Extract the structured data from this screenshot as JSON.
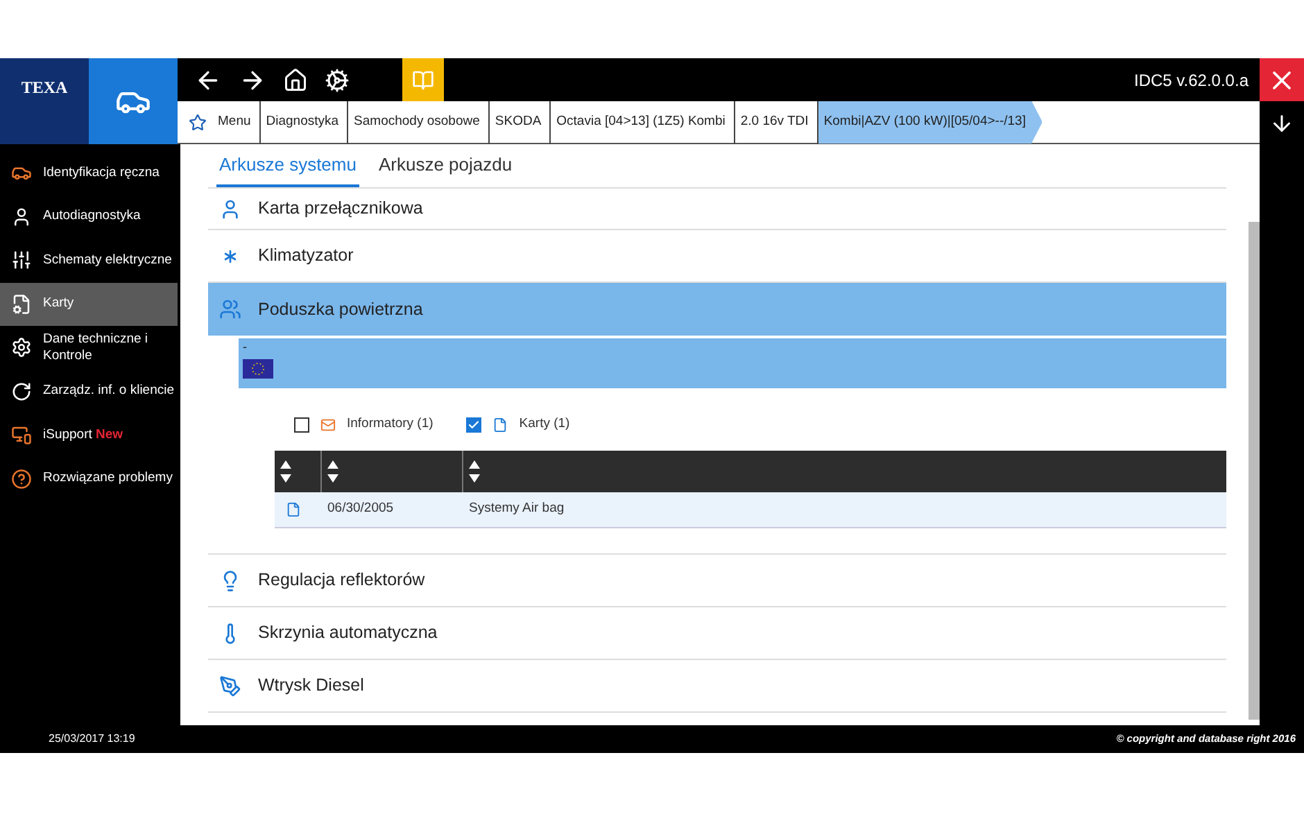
{
  "header": {
    "logo": "TEXA",
    "version": "IDC5 v.62.0.0.a"
  },
  "breadcrumb": [
    {
      "label": "Menu",
      "selected": false
    },
    {
      "label": "Diagnostyka",
      "selected": false
    },
    {
      "label": "Samochody osobowe",
      "selected": false
    },
    {
      "label": "SKODA",
      "selected": false
    },
    {
      "label": "Octavia [04>13] (1Z5) Kombi",
      "selected": false
    },
    {
      "label": "2.0 16v TDI",
      "selected": false
    },
    {
      "label": "Kombi|AZV (100 kW)|[05/04>--/13]",
      "selected": true
    }
  ],
  "sidebar": {
    "items": [
      {
        "label": "Identyfikacja ręczna",
        "selected": false
      },
      {
        "label": "Autodiagnostyka",
        "selected": false
      },
      {
        "label": "Schematy elektryczne",
        "selected": false
      },
      {
        "label": "Karty",
        "selected": true
      },
      {
        "label": "Dane techniczne i Kontrole",
        "selected": false
      },
      {
        "label": "Zarządz. inf. o kliencie",
        "selected": false
      },
      {
        "label": "iSupport",
        "badge": "New",
        "selected": false
      },
      {
        "label": "Rozwiązane problemy",
        "selected": false
      }
    ]
  },
  "tabs": [
    {
      "label": "Arkusze systemu",
      "selected": true
    },
    {
      "label": "Arkusze pojazdu",
      "selected": false
    }
  ],
  "sections": [
    {
      "label": "Karta przełącznikowa",
      "selected": false
    },
    {
      "label": "Klimatyzator",
      "selected": false
    },
    {
      "label": "Poduszka powietrzna",
      "selected": true,
      "detail": {
        "title": "-",
        "filters": [
          {
            "label": "Informatory (1)",
            "checked": false
          },
          {
            "label": "Karty (1)",
            "checked": true
          }
        ],
        "rows": [
          {
            "date": "06/30/2005",
            "name": "Systemy Air bag"
          }
        ]
      }
    },
    {
      "label": "Regulacja reflektorów",
      "selected": false
    },
    {
      "label": "Skrzynia automatyczna",
      "selected": false
    },
    {
      "label": "Wtrysk Diesel",
      "selected": false
    }
  ],
  "status_bar": {
    "datetime": "25/03/2017 13:19",
    "copyright": "© copyright and database right 2016"
  }
}
